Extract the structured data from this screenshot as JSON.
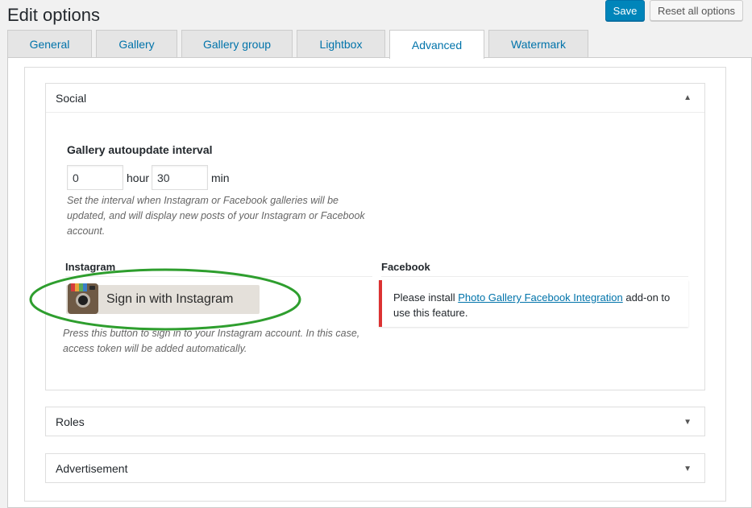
{
  "page": {
    "title": "Edit options",
    "save_label": "Save",
    "reset_label": "Reset all options"
  },
  "tabs": [
    {
      "label": "General"
    },
    {
      "label": "Gallery"
    },
    {
      "label": "Gallery group"
    },
    {
      "label": "Lightbox"
    },
    {
      "label": "Advanced",
      "active": true
    },
    {
      "label": "Watermark"
    }
  ],
  "panels": {
    "social": {
      "title": "Social",
      "autoupdate": {
        "label": "Gallery autoupdate interval",
        "hour_value": "0",
        "hour_unit": "hour",
        "min_value": "30",
        "min_unit": "min",
        "description": "Set the interval when Instagram or Facebook galleries will be updated, and will display new posts of your Instagram or Facebook account."
      },
      "instagram": {
        "heading": "Instagram",
        "button_label": "Sign in with Instagram",
        "description": "Press this button to sign in to your Instagram account. In this case, access token will be added automatically."
      },
      "facebook": {
        "heading": "Facebook",
        "notice_prefix": "Please install ",
        "notice_link": "Photo Gallery Facebook Integration",
        "notice_suffix": " add-on to use this feature."
      }
    },
    "roles": {
      "title": "Roles"
    },
    "advertisement": {
      "title": "Advertisement"
    }
  },
  "colors": {
    "primary": "#0085ba",
    "link": "#0073aa",
    "error_border": "#dc3232",
    "highlight_ellipse": "#2e9e2e"
  },
  "icons": {
    "panel_open": "triangle-up",
    "panel_closed": "triangle-down",
    "instagram": "instagram-camera-icon"
  }
}
